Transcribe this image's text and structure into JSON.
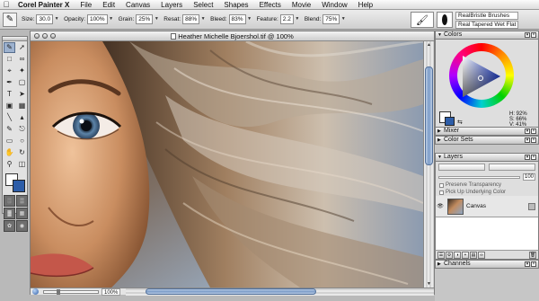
{
  "menubar": {
    "apple": "",
    "items": [
      "Corel Painter X",
      "File",
      "Edit",
      "Canvas",
      "Layers",
      "Select",
      "Shapes",
      "Effects",
      "Movie",
      "Window",
      "Help"
    ]
  },
  "property_bar": {
    "size_label": "Size:",
    "size_value": "30.0",
    "opacity_label": "Opacity:",
    "opacity_value": "100%",
    "grain_label": "Grain:",
    "grain_value": "25%",
    "resat_label": "Resat:",
    "resat_value": "88%",
    "bleed_label": "Bleed:",
    "bleed_value": "83%",
    "feature_label": "Feature:",
    "feature_value": "2.2",
    "blend_label": "Blend:",
    "blend_value": "75%"
  },
  "brush_selector": {
    "category": "RealBristle Brushes",
    "variant": "Real Tapered Wet Flat"
  },
  "document": {
    "title": "Heather Michelle Bjoershol.tif @ 100%",
    "zoom": "100%"
  },
  "panels": {
    "colors": {
      "title": "Colors",
      "h": "H: 92%",
      "s": "S: 66%",
      "v": "V: 41%"
    },
    "mixer": {
      "title": "Mixer"
    },
    "color_sets": {
      "title": "Color Sets"
    },
    "layers": {
      "title": "Layers",
      "opacity_value": "100",
      "preserve_transparency": "Preserve Transparency",
      "pick_up_underlying": "Pick Up Underlying Color",
      "layer_name": "Canvas"
    },
    "channels": {
      "title": "Channels"
    }
  },
  "colors": {
    "main": "#ffffff",
    "additional": "#2d5da8",
    "accent": "#5b7fb8"
  }
}
